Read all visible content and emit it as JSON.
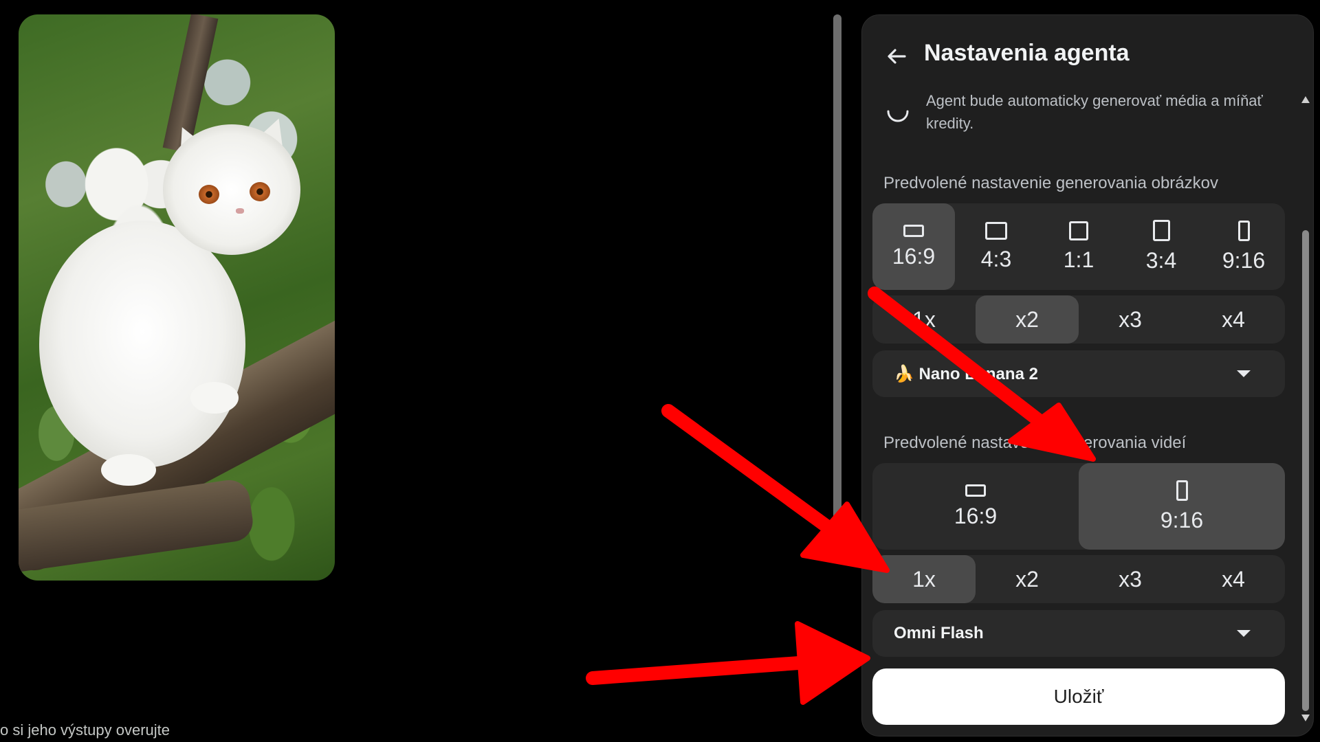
{
  "panel": {
    "title": "Nastavenia agenta",
    "agent_note": "Agent bude automaticky generovať média a míňať kredity.",
    "image_section": {
      "label": "Predvolené nastavenie generovania obrázkov",
      "ratios": [
        {
          "label": "16:9",
          "selected": true
        },
        {
          "label": "4:3",
          "selected": false
        },
        {
          "label": "1:1",
          "selected": false
        },
        {
          "label": "3:4",
          "selected": false
        },
        {
          "label": "9:16",
          "selected": false
        }
      ],
      "counts": [
        {
          "label": "1x",
          "selected": false
        },
        {
          "label": "x2",
          "selected": true
        },
        {
          "label": "x3",
          "selected": false
        },
        {
          "label": "x4",
          "selected": false
        }
      ],
      "model": "🍌 Nano Banana 2"
    },
    "video_section": {
      "label": "Predvolené nastavenie generovania videí",
      "ratios": [
        {
          "label": "16:9",
          "selected": false
        },
        {
          "label": "9:16",
          "selected": true
        }
      ],
      "counts": [
        {
          "label": "1x",
          "selected": true
        },
        {
          "label": "x2",
          "selected": false
        },
        {
          "label": "x3",
          "selected": false
        },
        {
          "label": "x4",
          "selected": false
        }
      ],
      "model": "Omni Flash"
    },
    "save_label": "Uložiť"
  },
  "footer_text": "o si jeho výstupy overujte",
  "colors": {
    "panel_bg": "#1f1f1f",
    "segment_bg": "#2a2a2a",
    "selected_bg": "#4a4a4a",
    "annotation_red": "#ff0000"
  }
}
